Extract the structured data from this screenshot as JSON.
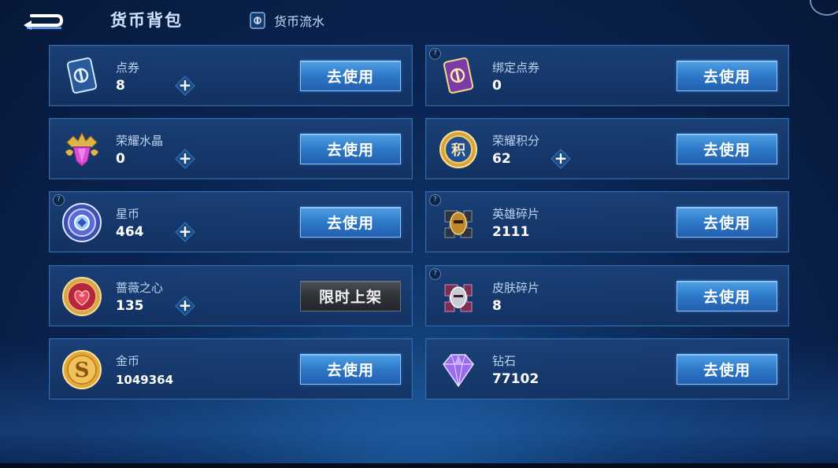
{
  "header": {
    "title": "货币背包",
    "flow_tab_label": "货币流水"
  },
  "colors": {
    "button_blue": "#2d78c8",
    "card_bg": "#1a4279",
    "card_border": "#2f6aab",
    "limited_button": "#2f3338"
  },
  "currencies": [
    {
      "name": "点券",
      "value": "8",
      "button": "去使用",
      "icon": "ticket-card-icon",
      "has_plus": true,
      "has_help": false
    },
    {
      "name": "绑定点券",
      "value": "0",
      "button": "去使用",
      "icon": "bound-ticket-card-icon",
      "has_plus": false,
      "has_help": true
    },
    {
      "name": "荣耀水晶",
      "value": "0",
      "button": "去使用",
      "icon": "glory-crystal-icon",
      "has_plus": true,
      "has_help": false
    },
    {
      "name": "荣耀积分",
      "value": "62",
      "button": "去使用",
      "icon": "glory-points-coin-icon",
      "has_plus": true,
      "has_help": false
    },
    {
      "name": "星币",
      "value": "464",
      "button": "去使用",
      "icon": "star-coin-icon",
      "has_plus": true,
      "has_help": true
    },
    {
      "name": "英雄碎片",
      "value": "2111",
      "button": "去使用",
      "icon": "hero-fragment-icon",
      "has_plus": false,
      "has_help": true
    },
    {
      "name": "蔷薇之心",
      "value": "135",
      "button": "限时上架",
      "icon": "rose-heart-icon",
      "has_plus": true,
      "has_help": false
    },
    {
      "name": "皮肤碎片",
      "value": "8",
      "button": "去使用",
      "icon": "skin-fragment-icon",
      "has_plus": false,
      "has_help": true
    },
    {
      "name": "金币",
      "value": "1049364",
      "button": "去使用",
      "icon": "gold-coin-icon",
      "has_plus": false,
      "has_help": false
    },
    {
      "name": "钻石",
      "value": "77102",
      "button": "去使用",
      "icon": "diamond-icon",
      "has_plus": false,
      "has_help": false
    }
  ]
}
